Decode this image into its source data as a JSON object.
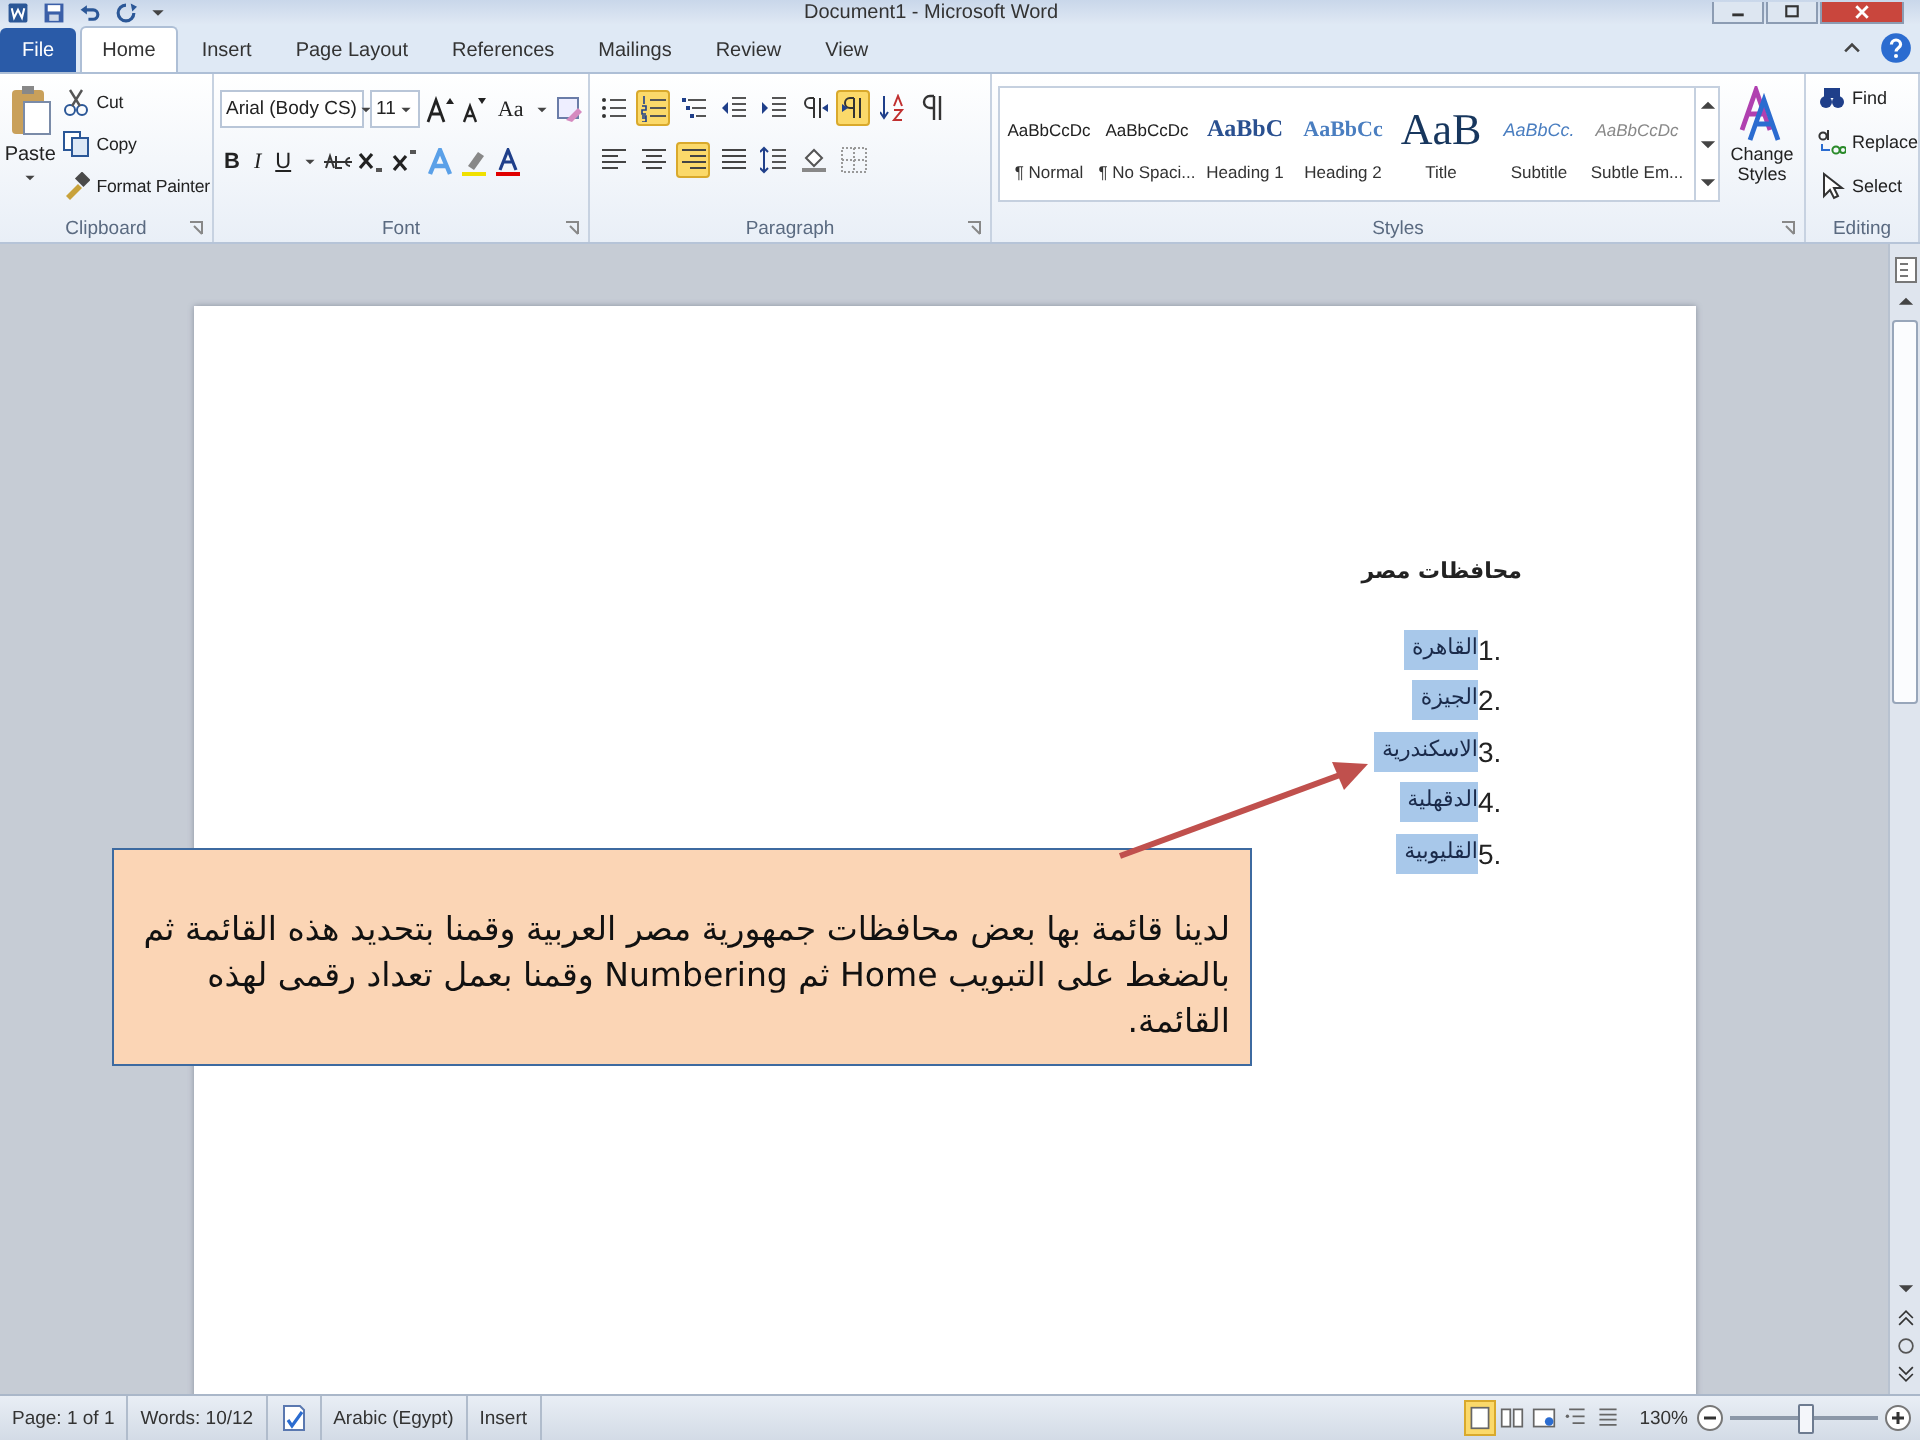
{
  "title_bar": {
    "title": "Document1 - Microsoft Word"
  },
  "tabs": [
    {
      "label": "File",
      "kind": "file",
      "selected": false
    },
    {
      "label": "Home",
      "kind": "tab",
      "selected": true
    },
    {
      "label": "Insert",
      "kind": "tab",
      "selected": false
    },
    {
      "label": "Page Layout",
      "kind": "tab",
      "selected": false
    },
    {
      "label": "References",
      "kind": "tab",
      "selected": false
    },
    {
      "label": "Mailings",
      "kind": "tab",
      "selected": false
    },
    {
      "label": "Review",
      "kind": "tab",
      "selected": false
    },
    {
      "label": "View",
      "kind": "tab",
      "selected": false
    }
  ],
  "clipboard": {
    "paste": "Paste",
    "items": [
      {
        "kind": "cut",
        "label": "Cut"
      },
      {
        "kind": "copy",
        "label": "Copy"
      },
      {
        "kind": "painter",
        "label": "Format Painter"
      }
    ],
    "label": "Clipboard"
  },
  "font": {
    "font_name": "Arial (Body CS)",
    "font_size": "11",
    "change_case": "Aa",
    "format_buttons": [
      {
        "kind": "bold",
        "label": "B"
      },
      {
        "kind": "italic",
        "label": "I"
      },
      {
        "kind": "underline",
        "label": "U"
      }
    ],
    "label": "Font"
  },
  "paragraph": {
    "row_1": [
      {
        "kind": "bullets",
        "selected": false
      },
      {
        "kind": "numbering",
        "selected": true
      },
      {
        "kind": "multilevel",
        "selected": false
      },
      {
        "kind": "decrease-indent",
        "selected": false
      },
      {
        "kind": "increase-indent",
        "selected": false
      },
      {
        "kind": "ltr",
        "selected": false
      },
      {
        "kind": "rtl",
        "selected": true
      },
      {
        "kind": "sort",
        "selected": false
      },
      {
        "kind": "marks",
        "selected": false
      }
    ],
    "row_2": [
      {
        "kind": "align-left",
        "selected": false
      },
      {
        "kind": "center",
        "selected": false
      },
      {
        "kind": "align-right",
        "selected": true
      },
      {
        "kind": "justify",
        "selected": false
      },
      {
        "kind": "line-spacing",
        "selected": false
      },
      {
        "kind": "shading",
        "selected": false
      },
      {
        "kind": "borders",
        "selected": false
      }
    ],
    "label": "Paragraph"
  },
  "styles": {
    "gallery": [
      {
        "kind": "normal",
        "preview": "AaBbCcDc",
        "name": "¶ Normal"
      },
      {
        "kind": "normal",
        "preview": "AaBbCcDc",
        "name": "¶ No Spaci..."
      },
      {
        "kind": "heading1",
        "preview": "AaBbC",
        "name": "Heading 1"
      },
      {
        "kind": "heading2",
        "preview": "AaBbCc",
        "name": "Heading 2"
      },
      {
        "kind": "title",
        "preview": "AaB",
        "name": "Title"
      },
      {
        "kind": "subtitle",
        "preview": "AaBbCc.",
        "name": "Subtitle"
      },
      {
        "kind": "emphasis",
        "preview": "AaBbCcDc",
        "name": "Subtle Em..."
      }
    ],
    "change_styles": "Change Styles",
    "label": "Styles"
  },
  "editing": {
    "items": [
      {
        "kind": "find",
        "label": "Find"
      },
      {
        "kind": "replace",
        "label": "Replace"
      },
      {
        "kind": "select",
        "label": "Select"
      }
    ],
    "label": "Editing"
  },
  "document": {
    "heading": "محافظات مصر",
    "list": [
      {
        "number": "1.",
        "text": "القاهرة",
        "selected": true
      },
      {
        "number": "2.",
        "text": "الجيزة",
        "selected": true
      },
      {
        "number": "3.",
        "text": "الاسكندرية",
        "selected": true
      },
      {
        "number": "4.",
        "text": "الدقهلية",
        "selected": true
      },
      {
        "number": "5.",
        "text": "القليوبية",
        "selected": true
      }
    ]
  },
  "callout": {
    "text": "لدينا قائمة بها بعض محافظات جمهورية مصر العربية وقمنا بتحديد هذه القائمة ثم بالضغط على التبويب Home ثم Numbering وقمنا بعمل تعداد رقمى لهذه القائمة."
  },
  "status_bar": {
    "items": [
      "Page: 1 of 1",
      "Words: 10/12",
      "Arabic (Egypt)",
      "Insert"
    ],
    "views": [
      {
        "kind": "print",
        "selected": true
      },
      {
        "kind": "reading",
        "selected": false
      },
      {
        "kind": "web",
        "selected": false
      },
      {
        "kind": "outline",
        "selected": false
      },
      {
        "kind": "draft",
        "selected": false
      }
    ],
    "zoom": "130%",
    "zoom_level": {
      "level": 0.5
    }
  }
}
